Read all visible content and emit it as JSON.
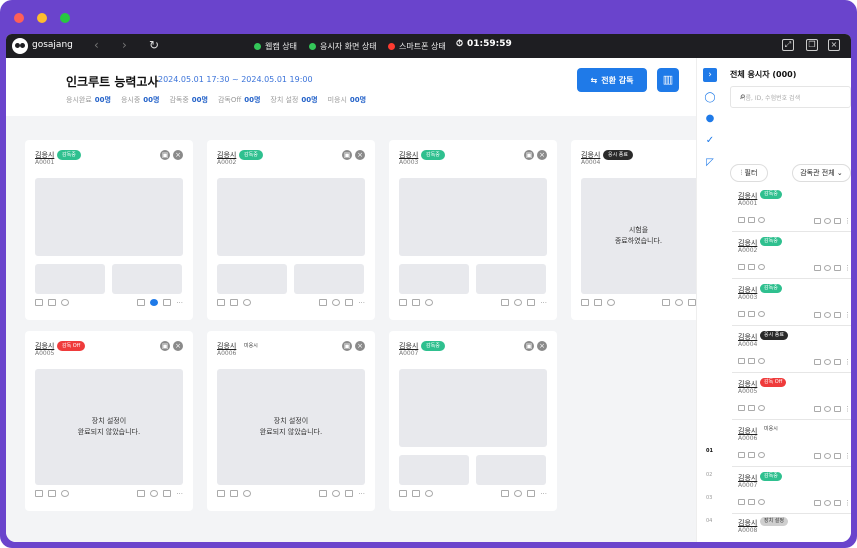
{
  "topbar": {
    "brand": "gosajang",
    "statuses": [
      {
        "label": "웹캠 상태",
        "color": "#34c759"
      },
      {
        "label": "응시자 화면 상태",
        "color": "#34c759"
      },
      {
        "label": "스마트폰 상태",
        "color": "#ff3b30"
      }
    ],
    "timer": "01:59:59"
  },
  "header": {
    "title": "인크루트 능력고사",
    "period": "2024.05.01  17:30 ~ 2024.05.01 19:00",
    "stats": [
      {
        "label": "응시완료",
        "value": "00명"
      },
      {
        "label": "응시중",
        "value": "00명"
      },
      {
        "label": "감독중",
        "value": "00명"
      },
      {
        "label": "감독Off",
        "value": "00명"
      },
      {
        "label": "장치 설정",
        "value": "00명"
      },
      {
        "label": "미응시",
        "value": "00명"
      }
    ],
    "switch_label": "전환 감독"
  },
  "cards": [
    {
      "name": "김응시",
      "id": "A0001",
      "badge": "감독중"
    },
    {
      "name": "김응시",
      "id": "A0002",
      "badge": "감독중"
    },
    {
      "name": "김응시",
      "id": "A0003",
      "badge": "감독중"
    },
    {
      "name": "김응시",
      "id": "A0004",
      "badge": "응시 종료",
      "message": "시험을\n종료하였습니다."
    },
    {
      "name": "김응시",
      "id": "A0005",
      "badge": "감독 Off",
      "message": "장치 설정이\n완료되지 않았습니다."
    },
    {
      "name": "김응시",
      "id": "A0006",
      "badge": "미응시",
      "message": "장치 설정이\n완료되지 않았습니다."
    },
    {
      "name": "김응시",
      "id": "A0007",
      "badge": "감독중"
    }
  ],
  "panel": {
    "title": "전체 응시자 (000)",
    "search_placeholder": "이름, ID, 수험번호 검색",
    "filter_label": "필터",
    "sort_label": "감독관 전체",
    "items": [
      {
        "name": "김응시",
        "id": "A0001",
        "badge": "감독중"
      },
      {
        "name": "김응시",
        "id": "A0002",
        "badge": "감독중"
      },
      {
        "name": "김응시",
        "id": "A0003",
        "badge": "감독중"
      },
      {
        "name": "김응시",
        "id": "A0004",
        "badge": "응시 종료"
      },
      {
        "name": "김응시",
        "id": "A0005",
        "badge": "감독 Off"
      },
      {
        "name": "김응시",
        "id": "A0006",
        "badge": "미응시"
      },
      {
        "name": "김응시",
        "id": "A0007",
        "badge": "감독중"
      },
      {
        "name": "김응시",
        "id": "A0008",
        "badge": "장치 설정"
      }
    ]
  },
  "pagination": [
    "01",
    "02",
    "03",
    "04"
  ],
  "colors": {
    "accent": "#1f7ae8",
    "frame": "#6a44cc",
    "badge_green": "#2fc08f",
    "badge_red": "#ef3b3b"
  }
}
